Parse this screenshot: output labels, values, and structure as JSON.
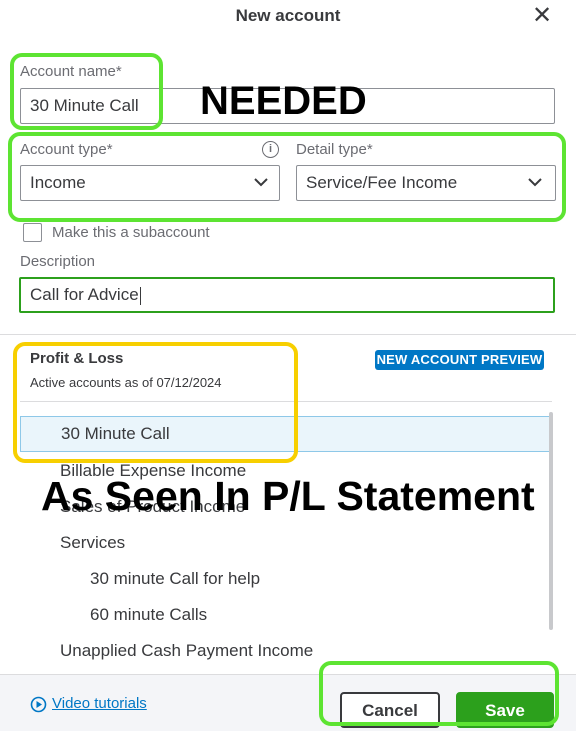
{
  "dialog": {
    "title": "New account",
    "close_icon": "close-icon"
  },
  "form": {
    "account_name": {
      "label": "Account name*",
      "value": "30 Minute Call"
    },
    "account_type": {
      "label": "Account type*",
      "value": "Income",
      "info_icon": "info-icon"
    },
    "detail_type": {
      "label": "Detail type*",
      "value": "Service/Fee Income"
    },
    "subaccount": {
      "label": "Make this a subaccount",
      "checked": false
    },
    "description": {
      "label": "Description",
      "value": "Call for Advice"
    }
  },
  "preview": {
    "title": "Profit & Loss",
    "subtitle": "Active accounts as of 07/12/2024",
    "badge": "NEW ACCOUNT PREVIEW",
    "accounts": [
      {
        "name": "30 Minute Call",
        "selected": true
      },
      {
        "name": "Billable Expense Income"
      },
      {
        "name": "Sales of Product Income"
      },
      {
        "name": "Services"
      },
      {
        "name": "30 minute Call for help",
        "indent": 1
      },
      {
        "name": "60 minute Calls",
        "indent": 1
      },
      {
        "name": "Unapplied Cash Payment Income"
      }
    ]
  },
  "footer": {
    "video_link": "Video tutorials",
    "cancel_label": "Cancel",
    "save_label": "Save"
  },
  "annotations": {
    "needed": "NEEDED",
    "statement": "As Seen In P/L Statement"
  },
  "colors": {
    "primary_green": "#2ca01c",
    "link_blue": "#0077c5",
    "highlight_green": "#5de432",
    "highlight_yellow": "#f7cf00"
  }
}
